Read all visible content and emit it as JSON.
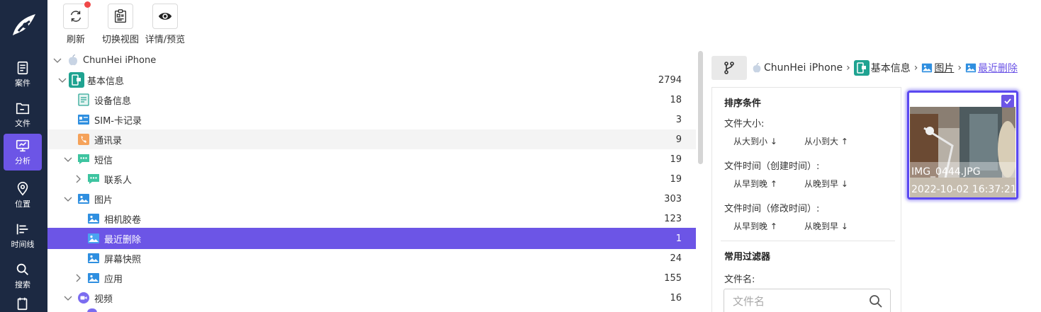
{
  "nav": {
    "items": [
      {
        "label": "案件",
        "icon": "clipboard-icon"
      },
      {
        "label": "文件",
        "icon": "folder-icon"
      },
      {
        "label": "分析",
        "icon": "monitor-chart-icon",
        "active": true
      },
      {
        "label": "位置",
        "icon": "location-pin-icon"
      },
      {
        "label": "时间线",
        "icon": "timeline-icon"
      },
      {
        "label": "搜索",
        "icon": "search-icon"
      }
    ]
  },
  "toolbar": {
    "refresh_label": "刷新",
    "switch_view_label": "切换视图",
    "details_label": "详情/预览"
  },
  "tree": {
    "rows": [
      {
        "label": "ChunHei iPhone",
        "count": ""
      },
      {
        "label": "基本信息",
        "count": "2794"
      },
      {
        "label": "设备信息",
        "count": "18"
      },
      {
        "label": "SIM-卡记录",
        "count": "3"
      },
      {
        "label": "通讯录",
        "count": "9"
      },
      {
        "label": "短信",
        "count": "19"
      },
      {
        "label": "联系人",
        "count": "19"
      },
      {
        "label": "图片",
        "count": "303"
      },
      {
        "label": "相机胶卷",
        "count": "123"
      },
      {
        "label": "最近删除",
        "count": "1"
      },
      {
        "label": "屏幕快照",
        "count": "24"
      },
      {
        "label": "应用",
        "count": "155"
      },
      {
        "label": "视频",
        "count": "16"
      }
    ]
  },
  "breadcrumb": {
    "device": "ChunHei iPhone",
    "basic": "基本信息",
    "pictures": "图片",
    "current": "最近删除",
    "separator": "›"
  },
  "filter": {
    "sort_title": "排序条件",
    "file_size_label": "文件大小:",
    "size_desc": "从大到小",
    "size_asc": "从小到大",
    "created_label": "文件时间（创建时间）:",
    "created_asc": "从早到晚",
    "created_desc": "从晚到早",
    "modified_label": "文件时间（修改时间）:",
    "modified_asc": "从早到晚",
    "modified_desc": "从晚到早",
    "common_title": "常用过滤器",
    "filename_label": "文件名:",
    "filename_placeholder": "文件名"
  },
  "thumbnail": {
    "name": "IMG_0444.JPG",
    "date": "2022-10-02 16:37:21",
    "checked": true
  },
  "colors": {
    "nav_bg": "#1c2942",
    "accent": "#6c55e6",
    "selected_border": "#5a48f0"
  }
}
